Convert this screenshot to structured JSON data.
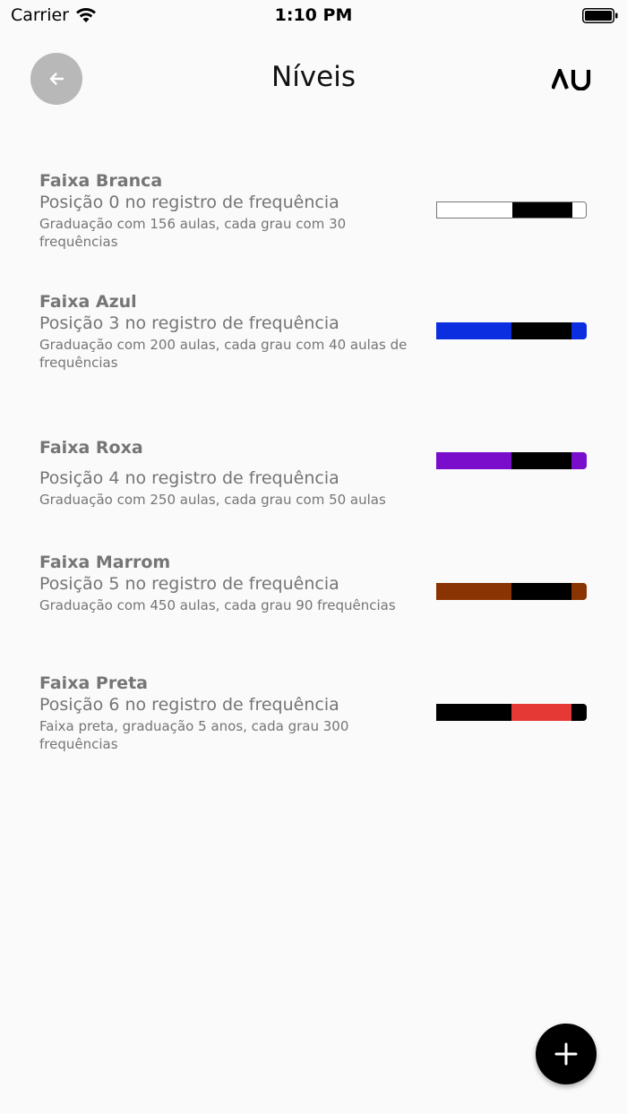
{
  "status_bar": {
    "carrier": "Carrier",
    "time": "1:10 PM"
  },
  "header": {
    "title": "Níveis",
    "logo_text": "AU"
  },
  "levels": [
    {
      "name": "Faixa Branca",
      "position": "Posição 0 no registro de frequência",
      "description": "Graduação com 156 aulas, cada grau com 30 frequências",
      "belt": {
        "main": "#ffffff",
        "bar": "#000000",
        "tip": "#ffffff",
        "outline": true
      }
    },
    {
      "name": "Faixa Azul",
      "position": "Posição 3 no registro de frequência",
      "description": "Graduação com 200 aulas, cada grau com 40 aulas de frequências",
      "belt": {
        "main": "#0a2ee0",
        "bar": "#000000",
        "tip": "#0a2ee0",
        "outline": false
      }
    },
    {
      "name": "Faixa Roxa",
      "position": "Posição 4 no registro de frequência",
      "description": "Graduação com 250 aulas, cada grau com 50 aulas",
      "belt": {
        "main": "#7a0ccc",
        "bar": "#000000",
        "tip": "#7a0ccc",
        "outline": false
      }
    },
    {
      "name": "Faixa Marrom",
      "position": "Posição 5 no registro de frequência",
      "description": "Graduação com 450 aulas,  cada grau 90 frequências",
      "belt": {
        "main": "#8a3404",
        "bar": "#000000",
        "tip": "#8a3404",
        "outline": false
      }
    },
    {
      "name": "Faixa Preta",
      "position": "Posição 6 no registro de frequência",
      "description": "Faixa preta, graduação 5 anos, cada grau 300 frequências",
      "belt": {
        "main": "#000000",
        "bar": "#e53935",
        "tip": "#000000",
        "outline": false
      }
    }
  ],
  "colors": {
    "background": "#fafafa",
    "back_button": "#b8b8b8",
    "fab": "#000000",
    "secondary_text": "#757575"
  },
  "icons": {
    "back": "arrow-left-icon",
    "add": "plus-icon",
    "wifi": "wifi-icon",
    "battery": "battery-icon"
  }
}
